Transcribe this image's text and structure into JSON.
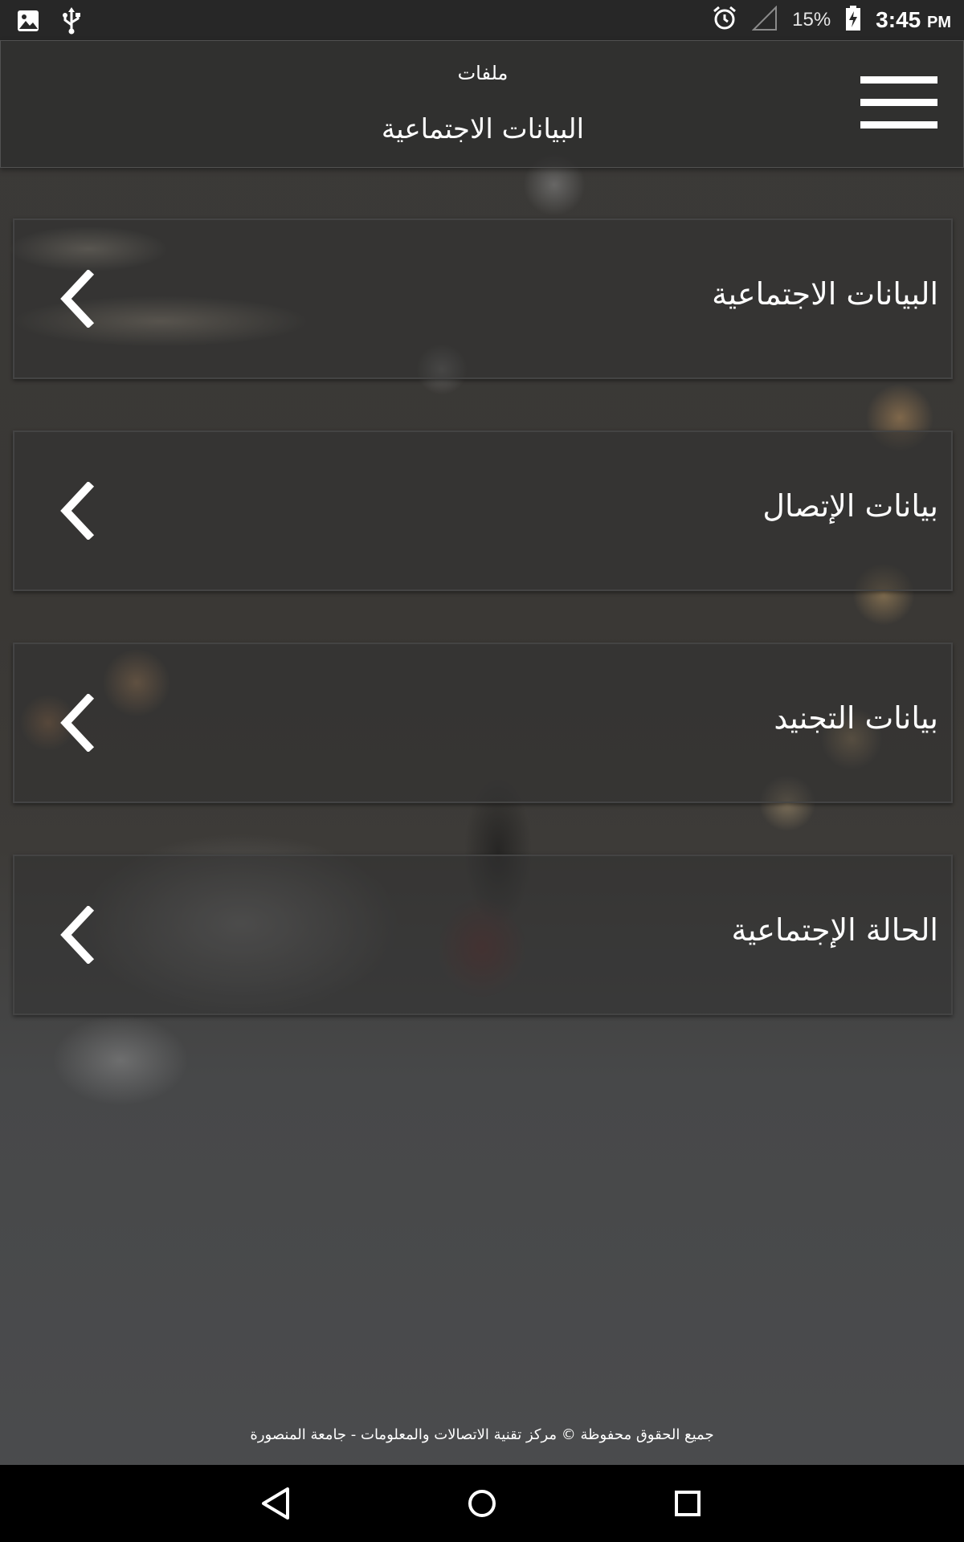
{
  "status_bar": {
    "icons": [
      "image-icon",
      "usb-icon",
      "alarm-icon",
      "signal-icon",
      "battery-charging-icon"
    ],
    "battery_percent": "15%",
    "time": "3:45",
    "time_suffix": "PM"
  },
  "header": {
    "subtitle": "ملفات",
    "title": "البيانات الاجتماعية",
    "menu_icon": "hamburger-icon"
  },
  "menu_items": [
    {
      "label": "البيانات الاجتماعية",
      "icon": "chevron-left-icon"
    },
    {
      "label": "بيانات الإتصال",
      "icon": "chevron-left-icon"
    },
    {
      "label": "بيانات التجنيد",
      "icon": "chevron-left-icon"
    },
    {
      "label": "الحالة الإجتماعية",
      "icon": "chevron-left-icon"
    }
  ],
  "footer": {
    "text": "جميع الحقوق محفوظة © مركز تقنية الاتصالات والمعلومات - جامعة المنصورة"
  },
  "nav_bar": {
    "buttons": [
      "back-icon",
      "home-icon",
      "recents-icon"
    ]
  },
  "colors": {
    "status_bar": "#272727",
    "nav_bar": "#000000",
    "text": "#ffffff"
  }
}
